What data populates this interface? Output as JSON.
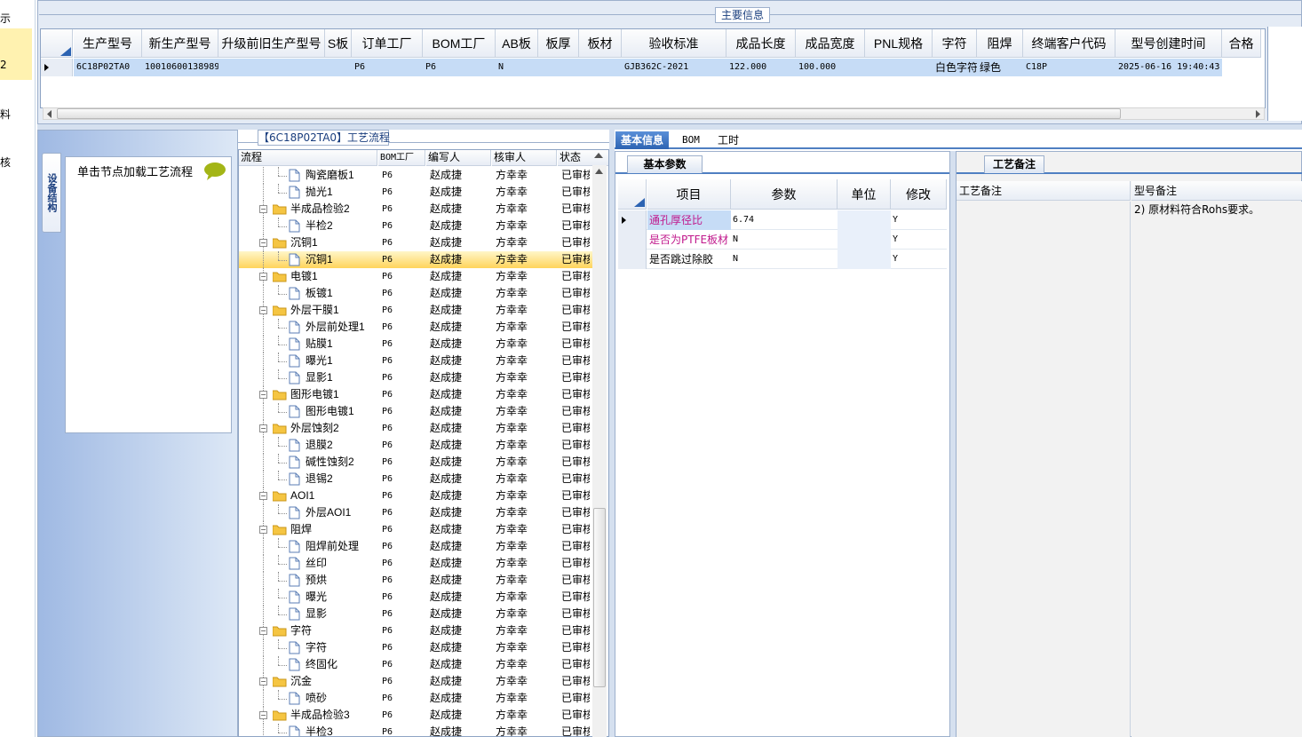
{
  "leftnav": {
    "items": [
      "示",
      "2",
      "料",
      "核"
    ]
  },
  "main_info": {
    "title": "主要信息",
    "columns": [
      "生产型号",
      "新生产型号",
      "升级前旧生产型号",
      "S板",
      "订单工厂",
      "BOM工厂",
      "AB板",
      "板厚",
      "板材",
      "验收标准",
      "成品长度",
      "成品宽度",
      "PNL规格",
      "字符",
      "阻焊",
      "终端客户代码",
      "型号创建时间",
      "合格"
    ],
    "row": [
      "6C18P02TA0",
      "10010600138989",
      "",
      "",
      "P6",
      "P6",
      "N",
      "",
      "",
      "GJB362C-2021",
      "122.000",
      "100.000",
      "",
      "白色字符",
      "绿色",
      "C18P",
      "2025-06-16 19:40:43"
    ]
  },
  "left_panel": {
    "vertical_tab": "设备结构",
    "hint": "单击节点加载工艺流程"
  },
  "process": {
    "title": "【6C18P02TA0】工艺流程",
    "columns": [
      "流程",
      "BOM工厂",
      "编写人",
      "核审人",
      "状态"
    ],
    "rows": [
      {
        "name": "陶瓷磨板1",
        "level": 2,
        "bom": "P6",
        "writer": "赵成捷",
        "reviewer": "方幸幸",
        "status": "已审核"
      },
      {
        "name": "抛光1",
        "level": 2,
        "bom": "P6",
        "writer": "赵成捷",
        "reviewer": "方幸幸",
        "status": "已审核"
      },
      {
        "name": "半成品检验2",
        "level": 1,
        "bom": "P6",
        "writer": "赵成捷",
        "reviewer": "方幸幸",
        "status": "已审核"
      },
      {
        "name": "半检2",
        "level": 2,
        "bom": "P6",
        "writer": "赵成捷",
        "reviewer": "方幸幸",
        "status": "已审核"
      },
      {
        "name": "沉铜1",
        "level": 1,
        "bom": "P6",
        "writer": "赵成捷",
        "reviewer": "方幸幸",
        "status": "已审核"
      },
      {
        "name": "沉铜1",
        "level": 2,
        "bom": "P6",
        "writer": "赵成捷",
        "reviewer": "方幸幸",
        "status": "已审核",
        "selected": true
      },
      {
        "name": "电镀1",
        "level": 1,
        "bom": "P6",
        "writer": "赵成捷",
        "reviewer": "方幸幸",
        "status": "已审核"
      },
      {
        "name": "板镀1",
        "level": 2,
        "bom": "P6",
        "writer": "赵成捷",
        "reviewer": "方幸幸",
        "status": "已审核"
      },
      {
        "name": "外层干膜1",
        "level": 1,
        "bom": "P6",
        "writer": "赵成捷",
        "reviewer": "方幸幸",
        "status": "已审核"
      },
      {
        "name": "外层前处理1",
        "level": 2,
        "bom": "P6",
        "writer": "赵成捷",
        "reviewer": "方幸幸",
        "status": "已审核"
      },
      {
        "name": "贴膜1",
        "level": 2,
        "bom": "P6",
        "writer": "赵成捷",
        "reviewer": "方幸幸",
        "status": "已审核"
      },
      {
        "name": "曝光1",
        "level": 2,
        "bom": "P6",
        "writer": "赵成捷",
        "reviewer": "方幸幸",
        "status": "已审核"
      },
      {
        "name": "显影1",
        "level": 2,
        "bom": "P6",
        "writer": "赵成捷",
        "reviewer": "方幸幸",
        "status": "已审核"
      },
      {
        "name": "图形电镀1",
        "level": 1,
        "bom": "P6",
        "writer": "赵成捷",
        "reviewer": "方幸幸",
        "status": "已审核"
      },
      {
        "name": "图形电镀1",
        "level": 2,
        "bom": "P6",
        "writer": "赵成捷",
        "reviewer": "方幸幸",
        "status": "已审核"
      },
      {
        "name": "外层蚀刻2",
        "level": 1,
        "bom": "P6",
        "writer": "赵成捷",
        "reviewer": "方幸幸",
        "status": "已审核"
      },
      {
        "name": "退膜2",
        "level": 2,
        "bom": "P6",
        "writer": "赵成捷",
        "reviewer": "方幸幸",
        "status": "已审核"
      },
      {
        "name": "碱性蚀刻2",
        "level": 2,
        "bom": "P6",
        "writer": "赵成捷",
        "reviewer": "方幸幸",
        "status": "已审核"
      },
      {
        "name": "退锡2",
        "level": 2,
        "bom": "P6",
        "writer": "赵成捷",
        "reviewer": "方幸幸",
        "status": "已审核"
      },
      {
        "name": "AOI1",
        "level": 1,
        "bom": "P6",
        "writer": "赵成捷",
        "reviewer": "方幸幸",
        "status": "已审核"
      },
      {
        "name": "外层AOI1",
        "level": 2,
        "bom": "P6",
        "writer": "赵成捷",
        "reviewer": "方幸幸",
        "status": "已审核"
      },
      {
        "name": "阻焊",
        "level": 1,
        "bom": "P6",
        "writer": "赵成捷",
        "reviewer": "方幸幸",
        "status": "已审核"
      },
      {
        "name": "阻焊前处理",
        "level": 2,
        "bom": "P6",
        "writer": "赵成捷",
        "reviewer": "方幸幸",
        "status": "已审核"
      },
      {
        "name": "丝印",
        "level": 2,
        "bom": "P6",
        "writer": "赵成捷",
        "reviewer": "方幸幸",
        "status": "已审核"
      },
      {
        "name": "预烘",
        "level": 2,
        "bom": "P6",
        "writer": "赵成捷",
        "reviewer": "方幸幸",
        "status": "已审核"
      },
      {
        "name": "曝光",
        "level": 2,
        "bom": "P6",
        "writer": "赵成捷",
        "reviewer": "方幸幸",
        "status": "已审核"
      },
      {
        "name": "显影",
        "level": 2,
        "bom": "P6",
        "writer": "赵成捷",
        "reviewer": "方幸幸",
        "status": "已审核"
      },
      {
        "name": "字符",
        "level": 1,
        "bom": "P6",
        "writer": "赵成捷",
        "reviewer": "方幸幸",
        "status": "已审核"
      },
      {
        "name": "字符",
        "level": 2,
        "bom": "P6",
        "writer": "赵成捷",
        "reviewer": "方幸幸",
        "status": "已审核"
      },
      {
        "name": "终固化",
        "level": 2,
        "bom": "P6",
        "writer": "赵成捷",
        "reviewer": "方幸幸",
        "status": "已审核"
      },
      {
        "name": "沉金",
        "level": 1,
        "bom": "P6",
        "writer": "赵成捷",
        "reviewer": "方幸幸",
        "status": "已审核"
      },
      {
        "name": "喷砂",
        "level": 2,
        "bom": "P6",
        "writer": "赵成捷",
        "reviewer": "方幸幸",
        "status": "已审核"
      },
      {
        "name": "半成品检验3",
        "level": 1,
        "bom": "P6",
        "writer": "赵成捷",
        "reviewer": "方幸幸",
        "status": "已审核"
      },
      {
        "name": "半检3",
        "level": 2,
        "bom": "P6",
        "writer": "赵成捷",
        "reviewer": "方幸幸",
        "status": "已审核"
      }
    ]
  },
  "tabs": [
    "基本信息",
    "BOM",
    "工时"
  ],
  "basic_params": {
    "subtab": "基本参数",
    "columns": [
      "项目",
      "参数",
      "单位",
      "修改"
    ],
    "rows": [
      {
        "item": "通孔厚径比",
        "value": "6.74",
        "unit": "",
        "modify": "Y",
        "color": "#c0188c"
      },
      {
        "item": "是否为PTFE板材",
        "value": "N",
        "unit": "",
        "modify": "Y",
        "color": "#c0188c"
      },
      {
        "item": "是否跳过除胶",
        "value": "N",
        "unit": "",
        "modify": "Y",
        "color": "#000000"
      }
    ]
  },
  "notes": {
    "subtab": "工艺备注",
    "process_note_label": "工艺备注",
    "model_note_label": "型号备注",
    "model_note_text": "2) 原材料符合Rohs要求。"
  },
  "colors": {
    "selected_row": "#c6dcf6",
    "highlight_row": "#ffd45b",
    "folder": "#f5c542",
    "accent": "#2c63b2"
  }
}
